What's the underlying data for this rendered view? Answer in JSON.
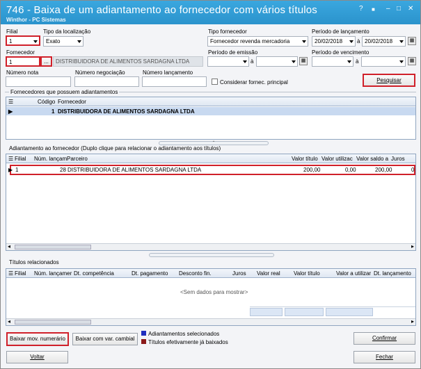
{
  "title": {
    "main": "746 - Baixa de um adiantamento ao fornecedor com vários títulos",
    "sub": "Winthor - PC Sistemas",
    "controls": [
      "?",
      "■",
      "–",
      "□",
      "✕"
    ]
  },
  "filters": {
    "filial_label": "Filial",
    "filial_value": "1",
    "tipo_localizacao_label": "Tipo da localização",
    "tipo_localizacao_value": "Exato",
    "tipo_fornecedor_label": "Tipo fornecedor",
    "tipo_fornecedor_value": "Fornecedor revenda mercadoria",
    "periodo_lancamento_label": "Período de lançamento",
    "periodo_lancamento_de": "20/02/2018",
    "periodo_lancamento_a_label": "à",
    "periodo_lancamento_ate": "20/02/2018",
    "fornecedor_label": "Fornecedor",
    "fornecedor_code": "1",
    "fornecedor_name": "DISTRIBUIDORA DE ALIMENTOS SARDAGNA LTDA",
    "periodo_emissao_label": "Período de emissão",
    "periodo_emissao_a_label": "à",
    "periodo_vencimento_label": "Período de vencimento",
    "periodo_vencimento_a_label": "à",
    "numero_nota_label": "Número nota",
    "numero_negociacao_label": "Número negociação",
    "numero_lancamento_label": "Número lançamento",
    "considerar_label": "Considerar fornec. principal",
    "pesquisar_label": "Pesquisar",
    "lookup_button": "..."
  },
  "fornecedores_grid": {
    "section_title": "Fornecedores que possuem adiantamentos",
    "columns": [
      "Código",
      "Fornecedor"
    ],
    "rows": [
      {
        "codigo": "1",
        "fornecedor": "DISTRIBUIDORA DE ALIMENTOS SARDAGNA LTDA"
      }
    ]
  },
  "adiantamento_grid": {
    "section_title": "Adiantamento ao fornecedor (Duplo clique para relacionar o adiantamento aos títulos)",
    "columns": [
      "Filial",
      "Núm. lançam",
      "Parceiro",
      "Valor título",
      "Valor utilizac",
      "Valor saldo a",
      "Juros"
    ],
    "rows": [
      {
        "filial": "1",
        "num_lancamento": "28",
        "parceiro": "DISTRIBUIDORA DE ALIMENTOS SARDAGNA LTDA",
        "valor_titulo": "200,00",
        "valor_utilizado": "0,00",
        "valor_saldo": "200,00",
        "juros": "0"
      }
    ]
  },
  "titulos_grid": {
    "section_title": "Títulos relacionados",
    "columns": [
      "Filial",
      "Núm. lançamer",
      "Dt. competência",
      "Dt. pagamento",
      "Desconto fin.",
      "Juros",
      "Valor real",
      "Valor título",
      "Valor a utilizar",
      "Dt. lançamento"
    ],
    "empty_text": "<Sem dados para mostrar>"
  },
  "footer": {
    "baixar_mov_label": "Baixar mov. numerário",
    "baixar_var_label": "Baixar com var. cambial",
    "legend_selecionados": "Adiantamentos selecionados",
    "legend_baixados": "Títulos efetivamente já baixados",
    "confirmar_label": "Confirmar",
    "voltar_label": "Voltar",
    "fechar_label": "Fechar"
  },
  "colors": {
    "titlebar": "#2f9bd4",
    "highlight": "#d0202a",
    "legend_selected": "#1f2fbf",
    "legend_done": "#8b1a1a"
  }
}
